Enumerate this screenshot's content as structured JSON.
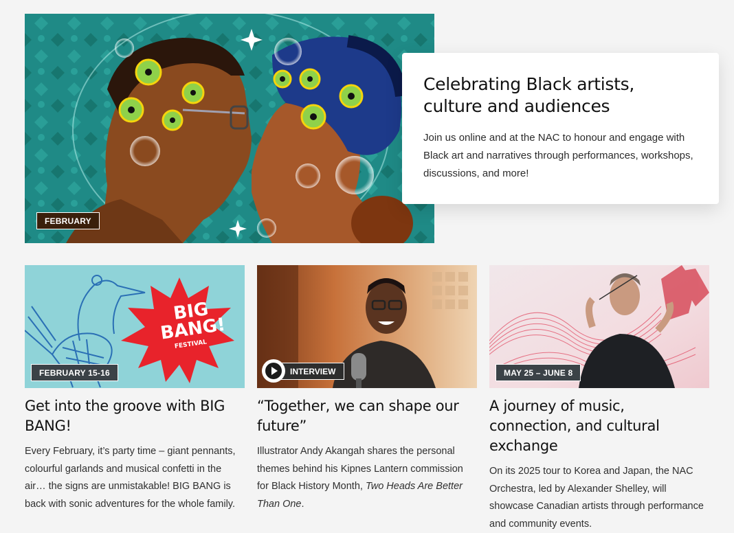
{
  "hero": {
    "badge": "FEBRUARY",
    "title": "Celebrating Black artists, culture and audiences",
    "text": "Join us online and at the NAC to honour and engage with Black art and narratives through performances, workshops, discussions, and more!"
  },
  "cards": [
    {
      "badge": "FEBRUARY 15-16",
      "title": "Get into the groove with BIG BANG!",
      "text": "Every February, it’s party time – giant pennants, colourful garlands and musical confetti in the air… the signs are unmistakable! BIG BANG is back with sonic adventures for the whole family.",
      "logo_line1": "BIG",
      "logo_line2": "BANG!",
      "logo_line3": "FESTIVAL"
    },
    {
      "badge": "INTERVIEW",
      "title": "“Together, we can shape our future”",
      "text_plain": "Illustrator Andy Akangah shares the personal themes behind his Kipnes Lantern commission for Black History Month, ",
      "text_italic": "Two Heads Are Better Than One",
      "text_end": "."
    },
    {
      "badge": "MAY 25 – JUNE 8",
      "title": "A journey of music, connection, and cultural exchange",
      "text": "On its 2025 tour to Korea and Japan, the NAC Orchestra, led by Alexander Shelley, will showcase Canadian artists through performance and community events."
    }
  ],
  "colors": {
    "hero_bg": "#1f8a86",
    "hero_badge_bg": "#3a1f0b",
    "card_badge_bg": "#3b4247",
    "bigbang_bg": "#8fd3d8",
    "bigbang_star": "#e8232b"
  }
}
